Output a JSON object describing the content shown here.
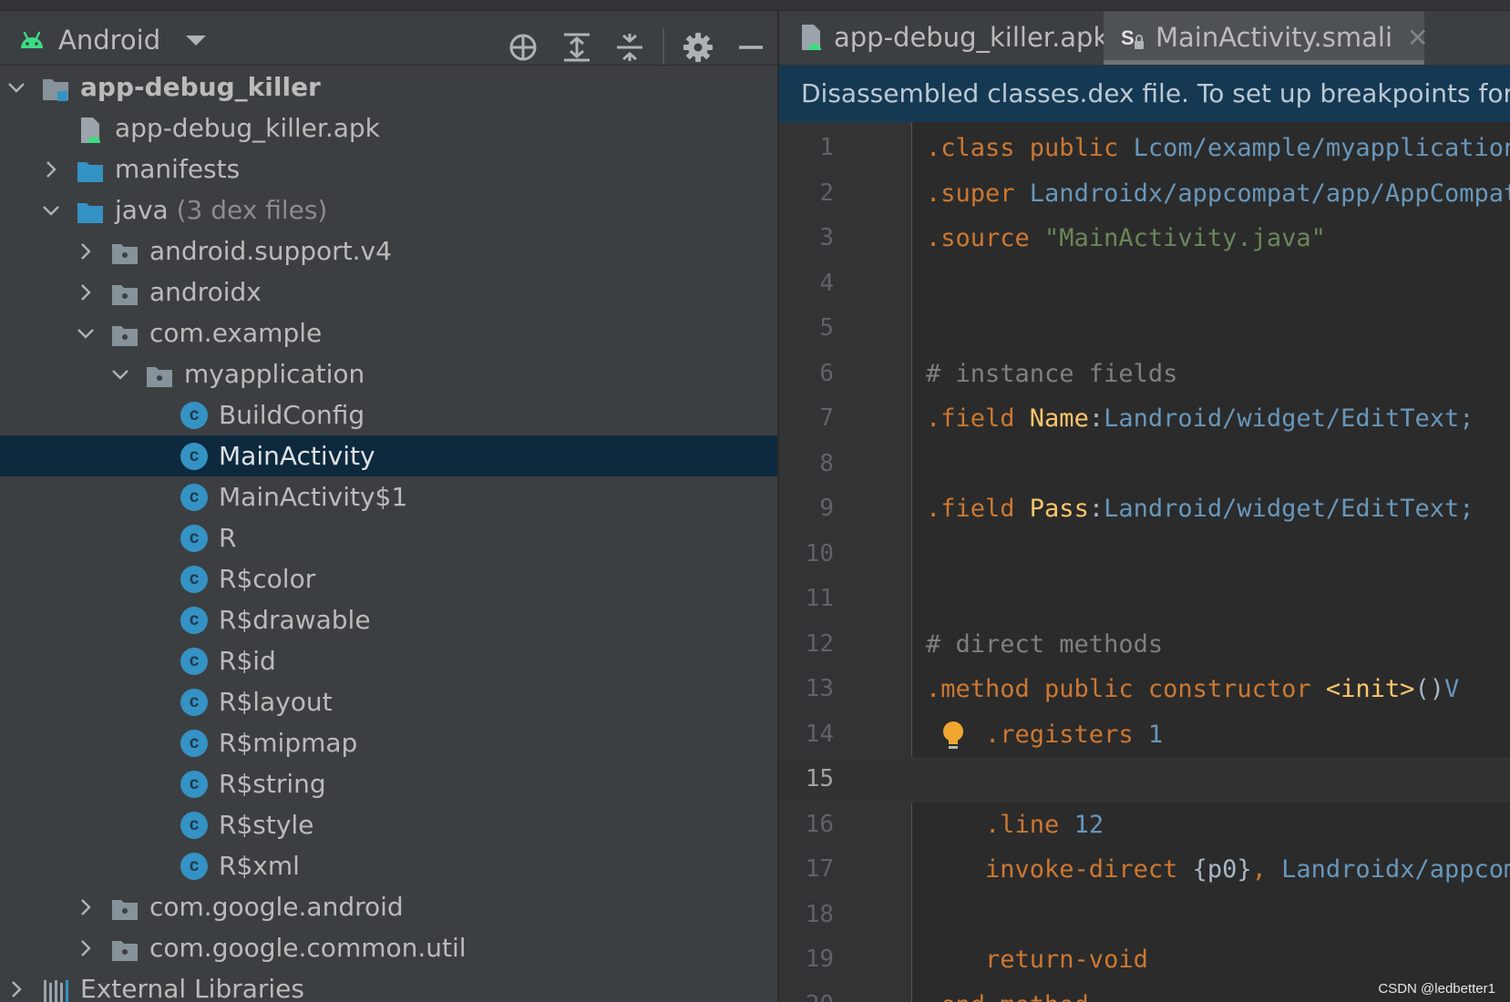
{
  "project_panel": {
    "view_name": "Android",
    "tree": [
      {
        "label": "app-debug_killer",
        "level": 0,
        "expand": "open",
        "icon": "module-icon",
        "bold": true
      },
      {
        "label": "app-debug_killer.apk",
        "level": 1,
        "expand": "none",
        "icon": "apk-file-icon"
      },
      {
        "label": "manifests",
        "level": 1,
        "expand": "closed",
        "icon": "folder-icon"
      },
      {
        "label": "java",
        "hint": "(3 dex files)",
        "level": 1,
        "expand": "open",
        "icon": "folder-icon"
      },
      {
        "label": "android.support.v4",
        "level": 2,
        "expand": "closed",
        "icon": "package-icon"
      },
      {
        "label": "androidx",
        "level": 2,
        "expand": "closed",
        "icon": "package-icon"
      },
      {
        "label": "com.example",
        "level": 2,
        "expand": "open",
        "icon": "package-icon"
      },
      {
        "label": "myapplication",
        "level": 3,
        "expand": "open",
        "icon": "package-icon"
      },
      {
        "label": "BuildConfig",
        "level": 4,
        "expand": "none",
        "icon": "class-icon"
      },
      {
        "label": "MainActivity",
        "level": 4,
        "expand": "none",
        "icon": "class-icon",
        "selected": true
      },
      {
        "label": "MainActivity$1",
        "level": 4,
        "expand": "none",
        "icon": "class-icon"
      },
      {
        "label": "R",
        "level": 4,
        "expand": "none",
        "icon": "class-icon"
      },
      {
        "label": "R$color",
        "level": 4,
        "expand": "none",
        "icon": "class-icon"
      },
      {
        "label": "R$drawable",
        "level": 4,
        "expand": "none",
        "icon": "class-icon"
      },
      {
        "label": "R$id",
        "level": 4,
        "expand": "none",
        "icon": "class-icon"
      },
      {
        "label": "R$layout",
        "level": 4,
        "expand": "none",
        "icon": "class-icon"
      },
      {
        "label": "R$mipmap",
        "level": 4,
        "expand": "none",
        "icon": "class-icon"
      },
      {
        "label": "R$string",
        "level": 4,
        "expand": "none",
        "icon": "class-icon"
      },
      {
        "label": "R$style",
        "level": 4,
        "expand": "none",
        "icon": "class-icon"
      },
      {
        "label": "R$xml",
        "level": 4,
        "expand": "none",
        "icon": "class-icon"
      },
      {
        "label": "com.google.android",
        "level": 2,
        "expand": "closed",
        "icon": "package-icon"
      },
      {
        "label": "com.google.common.util",
        "level": 2,
        "expand": "closed",
        "icon": "package-icon"
      },
      {
        "label": "External Libraries",
        "level": 0,
        "expand": "closed",
        "icon": "libraries-icon"
      }
    ]
  },
  "editor": {
    "tabs": [
      {
        "label": "app-debug_killer.apk",
        "icon": "apk-file-icon",
        "active": false
      },
      {
        "label": "MainActivity.smali",
        "icon": "smali-file-icon",
        "active": true
      }
    ],
    "banner": "Disassembled classes.dex file. To set up breakpoints for debugging, please attach Java source files.",
    "current_line": 15,
    "lines": [
      {
        "n": "1",
        "tokens": [
          {
            "t": ".class public ",
            "c": "kw"
          },
          {
            "t": "Lcom/example/myapplication/MainActivity;",
            "c": "type"
          }
        ]
      },
      {
        "n": "2",
        "tokens": [
          {
            "t": ".super ",
            "c": "kw"
          },
          {
            "t": "Landroidx/appcompat/app/AppCompatActivity;",
            "c": "type"
          }
        ]
      },
      {
        "n": "3",
        "tokens": [
          {
            "t": ".source ",
            "c": "kw"
          },
          {
            "t": "\"MainActivity.java\"",
            "c": "str"
          }
        ]
      },
      {
        "n": "4",
        "tokens": []
      },
      {
        "n": "5",
        "tokens": []
      },
      {
        "n": "6",
        "tokens": [
          {
            "t": "# instance fields",
            "c": "comment"
          }
        ]
      },
      {
        "n": "7",
        "tokens": [
          {
            "t": ".field ",
            "c": "kw"
          },
          {
            "t": "Name",
            "c": "ident"
          },
          {
            "t": ":",
            "c": "plain"
          },
          {
            "t": "Landroid/widget/EditText;",
            "c": "type"
          }
        ]
      },
      {
        "n": "8",
        "tokens": []
      },
      {
        "n": "9",
        "tokens": [
          {
            "t": ".field ",
            "c": "kw"
          },
          {
            "t": "Pass",
            "c": "ident"
          },
          {
            "t": ":",
            "c": "plain"
          },
          {
            "t": "Landroid/widget/EditText;",
            "c": "type"
          }
        ]
      },
      {
        "n": "10",
        "tokens": []
      },
      {
        "n": "11",
        "tokens": []
      },
      {
        "n": "12",
        "tokens": [
          {
            "t": "# direct methods",
            "c": "comment"
          }
        ]
      },
      {
        "n": "13",
        "tokens": [
          {
            "t": ".method public constructor ",
            "c": "kw"
          },
          {
            "t": "<init>",
            "c": "ident"
          },
          {
            "t": "()",
            "c": "plain"
          },
          {
            "t": "V",
            "c": "type"
          }
        ]
      },
      {
        "n": "14",
        "bulb": true,
        "tokens": [
          {
            "t": "    .registers ",
            "c": "kw"
          },
          {
            "t": "1",
            "c": "num"
          }
        ]
      },
      {
        "n": "15",
        "tokens": []
      },
      {
        "n": "16",
        "tokens": [
          {
            "t": "    .line ",
            "c": "kw"
          },
          {
            "t": "12",
            "c": "num"
          }
        ]
      },
      {
        "n": "17",
        "tokens": [
          {
            "t": "    invoke-direct ",
            "c": "kw"
          },
          {
            "t": "{p0}",
            "c": "plain"
          },
          {
            "t": ", ",
            "c": "kw"
          },
          {
            "t": "Landroidx/appcompat/app/AppCompatActivity;",
            "c": "type"
          }
        ]
      },
      {
        "n": "18",
        "tokens": []
      },
      {
        "n": "19",
        "tokens": [
          {
            "t": "    return-void",
            "c": "kw"
          }
        ]
      },
      {
        "n": "20",
        "tokens": [
          {
            "t": ".end method",
            "c": "kw"
          }
        ]
      }
    ]
  },
  "colors": {
    "kw": "#cc7832",
    "type": "#6897bb",
    "str": "#6a8759",
    "comment": "#808080",
    "ident": "#ffc66d",
    "num": "#6897bb",
    "plain": "#a9b7c6",
    "android_green": "#3ddc84",
    "selection": "#0d293e",
    "folder_blue": "#3592c4"
  },
  "watermark": "CSDN @ledbetter1"
}
